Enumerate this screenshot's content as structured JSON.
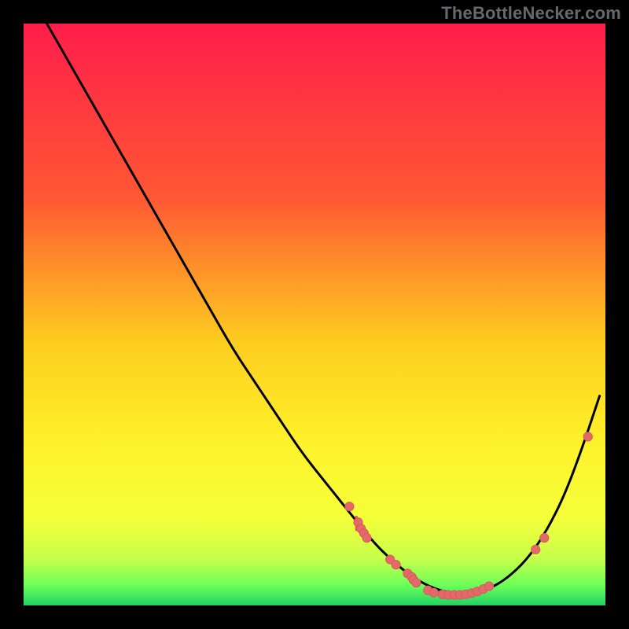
{
  "watermark": "TheBottleNecker.com",
  "colors": {
    "bg": "#000000",
    "curve": "#000000",
    "marker_fill": "#e46a6a",
    "marker_stroke": "#d85a5a",
    "band_bottom": "#24ff6e",
    "band_yellow": "#fef22a",
    "band_orange": "#fca22d",
    "band_red_top": "#ff1d4b"
  },
  "chart_data": {
    "type": "line",
    "title": "",
    "xlabel": "",
    "ylabel": "",
    "xlim": [
      0,
      100
    ],
    "ylim": [
      0,
      100
    ],
    "curve": {
      "x": [
        4,
        8,
        12,
        16,
        20,
        24,
        28,
        32,
        36,
        40,
        44,
        48,
        52,
        56,
        60,
        63,
        66,
        69,
        72,
        75,
        78,
        81,
        84,
        87,
        90,
        93,
        96,
        99
      ],
      "y": [
        100,
        93,
        86,
        79,
        72,
        65,
        58,
        51,
        44,
        38,
        32,
        26,
        21,
        16,
        11,
        8,
        5.5,
        3.6,
        2.4,
        2.0,
        2.2,
        3.3,
        5.4,
        8.5,
        13,
        19,
        27,
        36
      ]
    },
    "markers": [
      {
        "x": 56.0,
        "y": 17.0
      },
      {
        "x": 57.5,
        "y": 14.3
      },
      {
        "x": 58.0,
        "y": 13.2
      },
      {
        "x": 58.5,
        "y": 12.4
      },
      {
        "x": 59.0,
        "y": 11.6
      },
      {
        "x": 63.0,
        "y": 7.9
      },
      {
        "x": 64.0,
        "y": 7.0
      },
      {
        "x": 66.0,
        "y": 5.5
      },
      {
        "x": 66.7,
        "y": 4.9
      },
      {
        "x": 67.0,
        "y": 4.4
      },
      {
        "x": 67.5,
        "y": 3.9
      },
      {
        "x": 69.5,
        "y": 2.6
      },
      {
        "x": 70.5,
        "y": 2.2
      },
      {
        "x": 72.0,
        "y": 1.9
      },
      {
        "x": 73.0,
        "y": 1.8
      },
      {
        "x": 74.0,
        "y": 1.8
      },
      {
        "x": 75.0,
        "y": 1.8
      },
      {
        "x": 76.0,
        "y": 1.9
      },
      {
        "x": 77.0,
        "y": 2.1
      },
      {
        "x": 78.0,
        "y": 2.4
      },
      {
        "x": 79.0,
        "y": 2.8
      },
      {
        "x": 80.0,
        "y": 3.3
      },
      {
        "x": 88.0,
        "y": 9.6
      },
      {
        "x": 89.5,
        "y": 11.6
      },
      {
        "x": 97.0,
        "y": 29.0
      }
    ],
    "gradient_stops": [
      {
        "pos": 0.0,
        "color": "#ff1d4b"
      },
      {
        "pos": 0.3,
        "color": "#ff5833"
      },
      {
        "pos": 0.55,
        "color": "#fdce1f"
      },
      {
        "pos": 0.72,
        "color": "#fef22a"
      },
      {
        "pos": 0.85,
        "color": "#f5ff3a"
      },
      {
        "pos": 0.92,
        "color": "#c6ff4a"
      },
      {
        "pos": 0.965,
        "color": "#6dff59"
      },
      {
        "pos": 1.0,
        "color": "#1fd463"
      }
    ]
  }
}
